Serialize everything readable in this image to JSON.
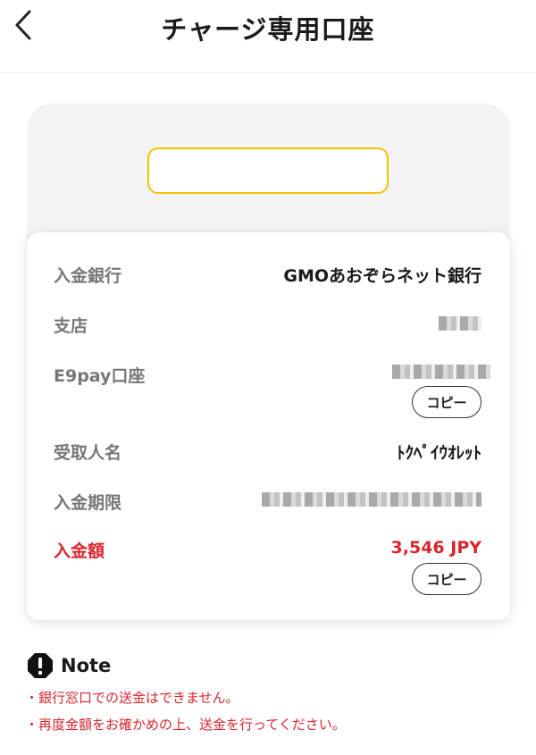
{
  "header": {
    "title": "チャージ専用口座"
  },
  "card": {
    "rows": [
      {
        "label": "入金銀行",
        "value": "GMOあおぞらネット銀行"
      },
      {
        "label": "支店",
        "value": ""
      },
      {
        "label": "E9pay口座",
        "value": ""
      },
      {
        "label": "受取人名",
        "value": "ﾄｸﾍﾟｲｳｵﾚｯﾄ"
      },
      {
        "label": "入金期限",
        "value": ""
      },
      {
        "label": "入金額",
        "value": "3,546 JPY"
      }
    ],
    "copy_label": "コピー"
  },
  "note": {
    "title": "Note",
    "items": [
      "・銀行窓口での送金はできません。",
      "・再度金額をお確かめの上、送金を行ってください。"
    ]
  },
  "colors": {
    "accent_red": "#d8262f",
    "highlight_yellow": "#f2c200"
  }
}
